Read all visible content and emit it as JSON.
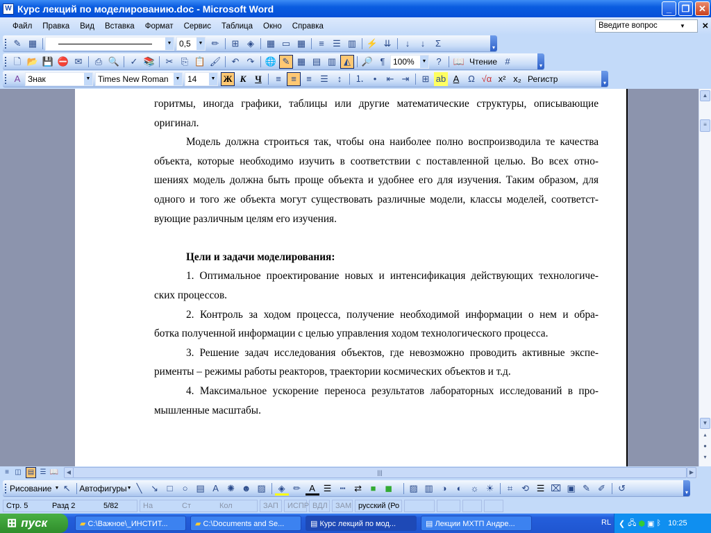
{
  "window": {
    "title": "Курс лекций по моделированию.doc - Microsoft Word",
    "icon": "word-doc-icon"
  },
  "menu": {
    "items": [
      "Файл",
      "Правка",
      "Вид",
      "Вставка",
      "Формат",
      "Сервис",
      "Таблица",
      "Окно",
      "Справка"
    ],
    "ask_placeholder": "Введите вопрос"
  },
  "toolbar_tables": {
    "line_weight": "0,5",
    "icons": [
      "draw-table-icon",
      "eraser-icon",
      "line-style-combo",
      "line-weight-combo",
      "border-color-icon",
      "border-icon",
      "shading-icon",
      "insert-table-icon",
      "merge-cells-icon",
      "split-cells-icon",
      "align-icon",
      "distribute-rows-icon",
      "distribute-cols-icon",
      "autoformat-icon",
      "text-direction-icon",
      "sort-asc-icon",
      "sort-desc-icon",
      "autosum-icon"
    ]
  },
  "toolbar_standard": {
    "zoom": "100%",
    "reading_label": "Чтение"
  },
  "toolbar_format": {
    "style": "Знак",
    "font": "Times New Roman",
    "size": "14",
    "bold": "Ж",
    "italic": "К",
    "underline": "Ч",
    "case_label": "Регистр"
  },
  "document": {
    "lines": [
      {
        "t": "горитмы, иногда графики, таблицы или другие математические структуры, описывающие",
        "c": ""
      },
      {
        "t": "оригинал.",
        "c": "last"
      },
      {
        "t": "Модель должна строиться так, чтобы она наиболее полно воспроизводила те качества",
        "c": "ind"
      },
      {
        "t": "объекта, которые необходимо изучить в соответствии с поставленной целью. Во всех отно-",
        "c": ""
      },
      {
        "t": "шениях модель должна быть проще объекта и удобнее его для изучения. Таким образом, для",
        "c": ""
      },
      {
        "t": "одного и того же объекта могут существовать различные модели, классы моделей, соответст-",
        "c": ""
      },
      {
        "t": "вующие различным целям его изучения.",
        "c": "last"
      },
      {
        "t": "",
        "c": "last"
      },
      {
        "t": "Цели и задачи моделирования:",
        "c": "ind last b"
      },
      {
        "t": "1. Оптимальное проектирование новых и интенсификация действующих технологиче-",
        "c": "ind"
      },
      {
        "t": "ских процессов.",
        "c": "last"
      },
      {
        "t": "2. Контроль за ходом процесса, получение необходимой информации о нем и обра-",
        "c": "ind"
      },
      {
        "t": "ботка полученной информации с целью управления ходом технологического процесса.",
        "c": "last"
      },
      {
        "t": "3. Решение задач исследования объектов, где невозможно проводить активные  экспе-",
        "c": "ind"
      },
      {
        "t": "рименты – режимы работы реакторов, траектории космических объектов и т.д.",
        "c": "last"
      },
      {
        "t": "4. Максимальное ускорение переноса результатов лабораторных исследований в про-",
        "c": "ind"
      },
      {
        "t": "мышленные масштабы.",
        "c": "last"
      }
    ]
  },
  "drawing": {
    "draw_label": "Рисование",
    "autoshapes_label": "Автофигуры"
  },
  "status": {
    "page": "Стр. 5",
    "section": "Разд 2",
    "pages": "5/82",
    "at": "На",
    "line": "Ст",
    "col": "Кол",
    "rec": "ЗАП",
    "trk": "ИСПР",
    "ext": "ВДЛ",
    "ovr": "ЗАМ",
    "lang": "русский (Ро"
  },
  "taskbar": {
    "start": "пуск",
    "tasks": [
      "C:\\Важное\\_ИНСТИТ...",
      "C:\\Documents and Se...",
      "Курс лекций по мод...",
      "Лекции МХТП Андре..."
    ],
    "active": 2,
    "lang": "RL",
    "clock": "10:25"
  }
}
